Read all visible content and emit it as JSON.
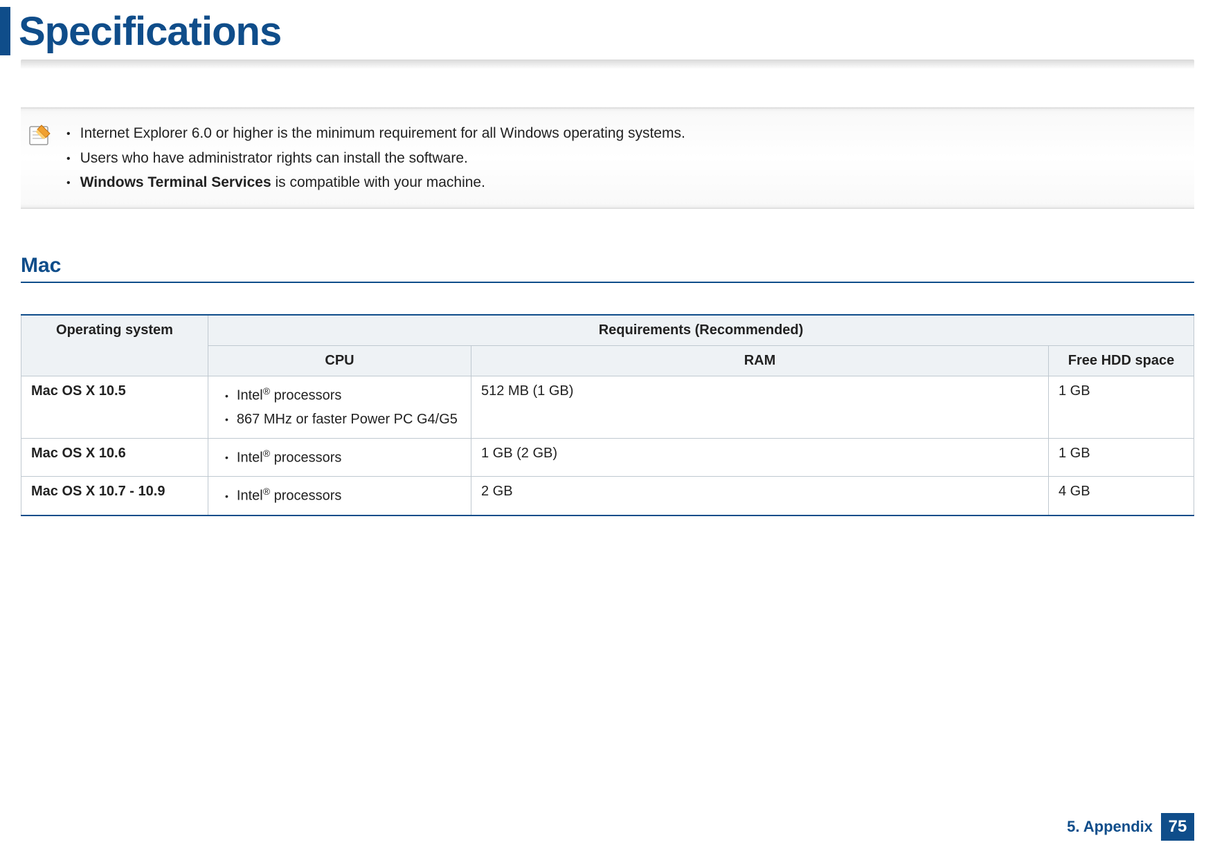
{
  "header": {
    "title": "Specifications"
  },
  "notes": {
    "items": [
      {
        "text": "Internet Explorer 6.0 or higher is the minimum requirement for all Windows operating systems."
      },
      {
        "bold": "Users who have administrator rights can install the software.",
        "text": ""
      },
      {
        "bold": "Windows Terminal Services",
        "text": " is compatible with your machine."
      }
    ]
  },
  "section": {
    "heading": "Mac"
  },
  "table": {
    "headers": {
      "os": "Operating system",
      "req": "Requirements (Recommended)",
      "cpu": "CPU",
      "ram": "RAM",
      "hdd": "Free HDD space"
    },
    "rows": [
      {
        "os": "Mac OS X 10.5",
        "cpu": [
          "Intel® processors",
          "867 MHz or faster Power PC G4/G5"
        ],
        "ram": "512 MB (1 GB)",
        "hdd": "1 GB"
      },
      {
        "os": "Mac OS X 10.6",
        "cpu": [
          "Intel® processors"
        ],
        "ram": "1 GB (2 GB)",
        "hdd": "1 GB"
      },
      {
        "os": "Mac OS X 10.7 - 10.9",
        "cpu": [
          "Intel® processors"
        ],
        "ram": "2 GB",
        "hdd": "4 GB"
      }
    ]
  },
  "footer": {
    "chapter": "5. Appendix",
    "page": "75"
  }
}
